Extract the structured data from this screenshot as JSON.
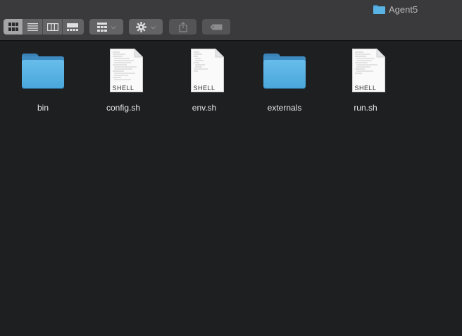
{
  "window": {
    "title": "Agent5"
  },
  "toolbar": {
    "view_buttons": [
      {
        "name": "icon-view",
        "icon": "grid-icon",
        "active": true
      },
      {
        "name": "list-view",
        "icon": "list-icon",
        "active": false
      },
      {
        "name": "column-view",
        "icon": "columns-icon",
        "active": false
      },
      {
        "name": "gallery-view",
        "icon": "gallery-icon",
        "active": false
      }
    ],
    "group_icon": "group-by-grid-icon",
    "action_icon": "gear-icon",
    "share_icon": "share-icon",
    "tag_icon": "tag-icon"
  },
  "files": [
    {
      "name": "bin",
      "kind": "folder"
    },
    {
      "name": "config.sh",
      "kind": "shell",
      "badge": "SHELL"
    },
    {
      "name": "env.sh",
      "kind": "shell",
      "badge": "SHELL"
    },
    {
      "name": "externals",
      "kind": "folder"
    },
    {
      "name": "run.sh",
      "kind": "shell",
      "badge": "SHELL"
    }
  ],
  "colors": {
    "background": "#1e1f21",
    "titlebar": "#3a3a3c",
    "folder": "#5ab3e5",
    "label": "#e6e6e6"
  }
}
